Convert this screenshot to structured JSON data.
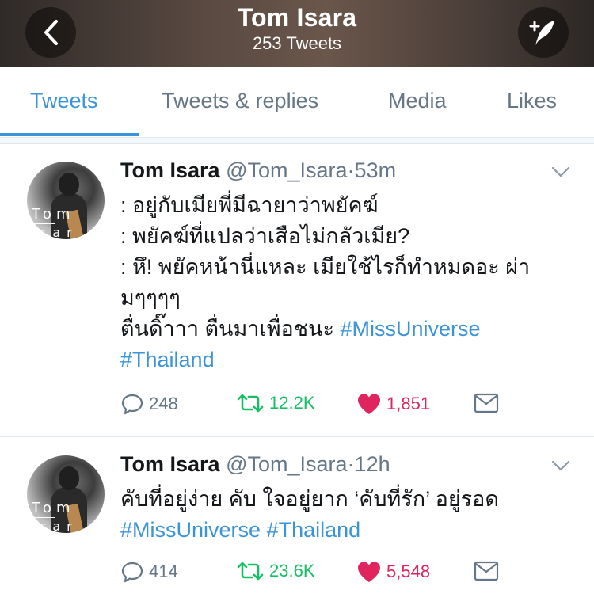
{
  "header": {
    "name": "Tom Isara",
    "tweet_count": "253 Tweets"
  },
  "tabs": [
    {
      "label": "Tweets",
      "active": true
    },
    {
      "label": "Tweets & replies",
      "active": false
    },
    {
      "label": "Media",
      "active": false
    },
    {
      "label": "Likes",
      "active": false
    }
  ],
  "colors": {
    "accent": "#3b94d9",
    "retweet": "#17bf63",
    "like": "#e0245e",
    "secondary_text": "#657786"
  },
  "icons": {
    "back": "chevron-left-icon",
    "compose": "compose-tweet-icon",
    "caret": "chevron-down-icon",
    "reply": "reply-icon",
    "retweet": "retweet-icon",
    "like": "heart-icon",
    "dm": "envelope-icon"
  },
  "tweets": [
    {
      "display_name": "Tom Isara",
      "handle": "@Tom_Isara",
      "dot": "·",
      "time": "53m",
      "lines": [
        ": อยู่กับเมียพี่มีฉายาว่าพยัคฆ์",
        ": พยัคฆ์ที่แปลว่าเสือไม่กลัวเมีย?",
        ": หึ! พยัคหน้านี่แหละ เมียใช้ไรก็ทำหมดอะ ผ่า",
        "มๆๆๆๆ"
      ],
      "line5_text": "ตื่นดิ๊าาา ตื่นมาเพื่อชนะ ",
      "hashtags": [
        "#MissUniverse",
        "#Thailand"
      ],
      "replies": "248",
      "retweets": "12.2K",
      "likes": "1,851"
    },
    {
      "display_name": "Tom Isara",
      "handle": "@Tom_Isara",
      "dot": "·",
      "time": "12h",
      "line1": "คับที่อยู่ง่าย คับ ใจอยู่ยาก ‘คับที่รัก’ อยู่รอด",
      "hashtags": [
        "#MissUniverse",
        "#Thailand"
      ],
      "replies": "414",
      "retweets": "23.6K",
      "likes": "5,548"
    }
  ]
}
